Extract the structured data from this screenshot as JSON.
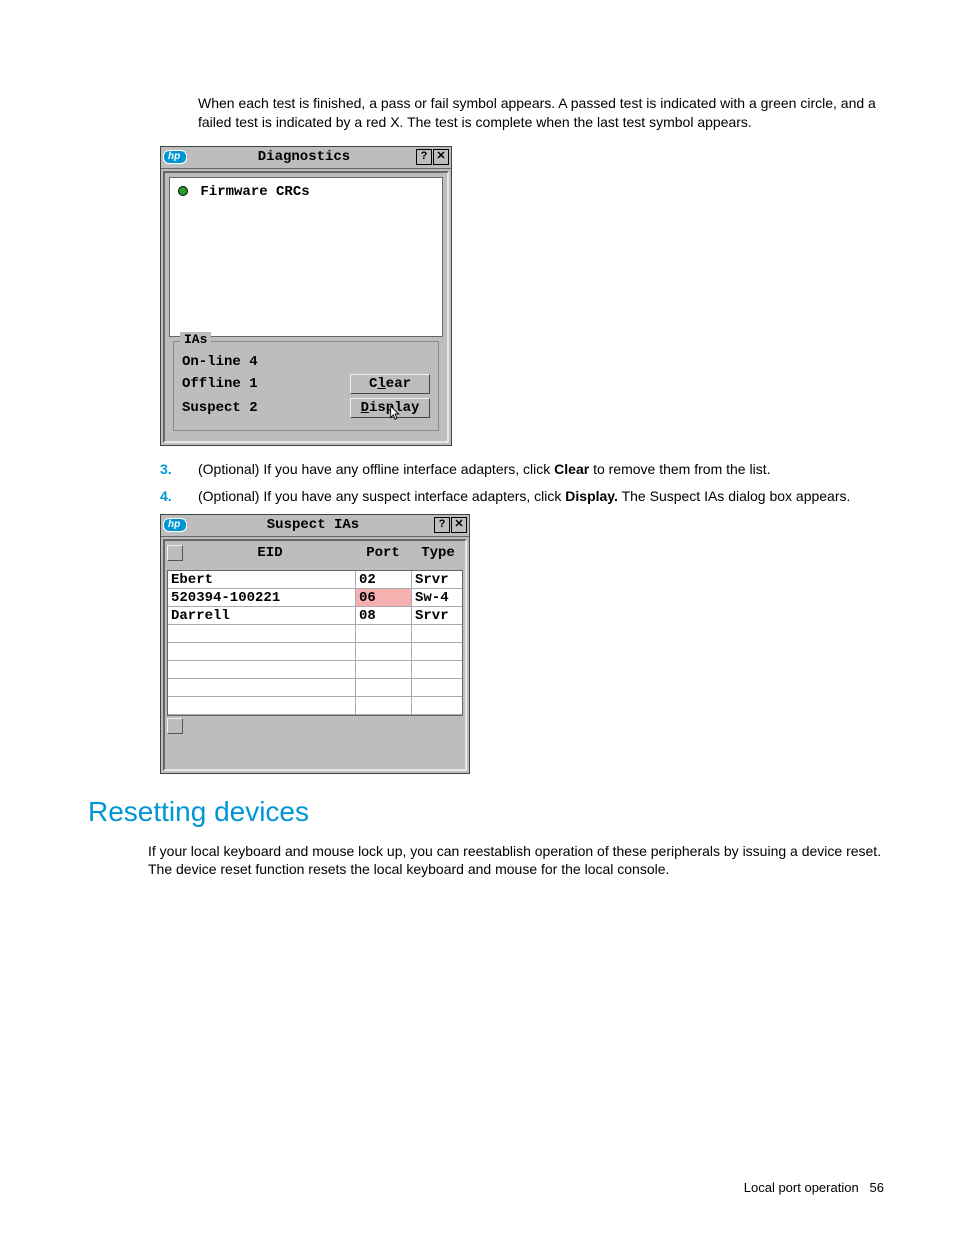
{
  "intro": "When each test is finished, a pass or fail symbol appears. A passed test is indicated with a green circle, and a failed test is indicated by a red X. The test is complete when the last test symbol appears.",
  "diagnostics": {
    "title": "Diagnostics",
    "help_glyph": "?",
    "close_glyph": "✕",
    "test_label": "Firmware CRCs",
    "ias_legend": "IAs",
    "stats": {
      "online_label": "On-line",
      "online_count": "4",
      "offline_label": "Offline",
      "offline_count": "1",
      "suspect_label": "Suspect",
      "suspect_count": "2"
    },
    "clear_pre": "C",
    "clear_u": "l",
    "clear_post": "ear",
    "display_pre": "",
    "display_u": "D",
    "display_mid": "is",
    "display_u2": "p",
    "display_post": "lay"
  },
  "step3_num": "3.",
  "step3_a": "(Optional) If you have any offline interface adapters, click ",
  "step3_b": "Clear",
  "step3_c": " to remove them from the list.",
  "step4_num": "4.",
  "step4_a": "(Optional) If you have any suspect interface adapters, click ",
  "step4_b": "Display.",
  "step4_c": " The Suspect IAs dialog box appears.",
  "suspect": {
    "title": "Suspect IAs",
    "help_glyph": "?",
    "close_glyph": "✕",
    "col_eid": "EID",
    "col_port": "Port",
    "col_type": "Type",
    "rows": [
      {
        "eid": "Ebert",
        "port": "02",
        "type": "Srvr",
        "hl": false
      },
      {
        "eid": "520394-100221",
        "port": "06",
        "type": "Sw-4",
        "hl": true
      },
      {
        "eid": "Darrell",
        "port": "08",
        "type": "Srvr",
        "hl": false
      }
    ]
  },
  "heading": "Resetting devices",
  "reset_text": "If your local keyboard and mouse lock up, you can reestablish operation of these peripherals by issuing a device reset. The device reset function resets the local keyboard and mouse for the local console.",
  "footer_label": "Local port operation",
  "footer_page": "56"
}
